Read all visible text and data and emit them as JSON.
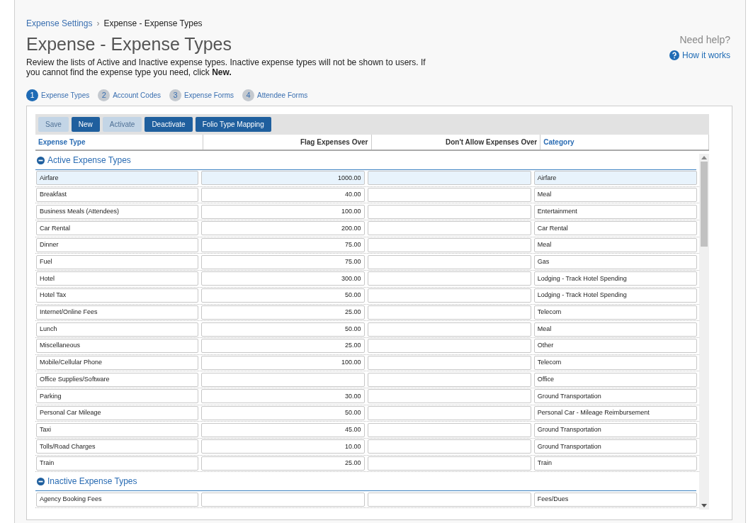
{
  "breadcrumb": {
    "parent": "Expense Settings",
    "separator": "›",
    "current": "Expense - Expense Types"
  },
  "title": "Expense - Expense Types",
  "description": "Review the lists of Active and Inactive expense types. Inactive expense types will not be shown to users. If you cannot find the expense type you need, click **New.**",
  "help": {
    "heading": "Need help?",
    "link": "How it works"
  },
  "steps": [
    {
      "number": "1",
      "label": "Expense Types",
      "selected": true
    },
    {
      "number": "2",
      "label": "Account Codes",
      "selected": false
    },
    {
      "number": "3",
      "label": "Expense Forms",
      "selected": false
    },
    {
      "number": "4",
      "label": "Attendee Forms",
      "selected": false
    }
  ],
  "toolbar": [
    {
      "label": "Save",
      "disabled": true
    },
    {
      "label": "New",
      "disabled": false
    },
    {
      "label": "Activate",
      "disabled": true
    },
    {
      "label": "Deactivate",
      "disabled": false
    },
    {
      "label": "Folio Type Mapping",
      "disabled": false
    }
  ],
  "columns": [
    {
      "label": "Expense Type",
      "highlighted": true
    },
    {
      "label": "Flag Expenses Over",
      "highlighted": false
    },
    {
      "label": "Don't Allow Expenses Over",
      "highlighted": false
    },
    {
      "label": "Category",
      "highlighted": true
    }
  ],
  "groups": [
    {
      "title": "Active Expense Types",
      "expanded": true,
      "rows": [
        {
          "cells": [
            "Airfare",
            "1000.00",
            "",
            "Airfare"
          ],
          "selected": true
        },
        {
          "cells": [
            "Breakfast",
            "40.00",
            "",
            "Meal"
          ],
          "selected": false
        },
        {
          "cells": [
            "Business Meals (Attendees)",
            "100.00",
            "",
            "Entertainment"
          ],
          "selected": false
        },
        {
          "cells": [
            "Car Rental",
            "200.00",
            "",
            "Car Rental"
          ],
          "selected": false
        },
        {
          "cells": [
            "Dinner",
            "75.00",
            "",
            "Meal"
          ],
          "selected": false
        },
        {
          "cells": [
            "Fuel",
            "75.00",
            "",
            "Gas"
          ],
          "selected": false
        },
        {
          "cells": [
            "Hotel",
            "300.00",
            "",
            "Lodging - Track Hotel Spending"
          ],
          "selected": false
        },
        {
          "cells": [
            "Hotel Tax",
            "50.00",
            "",
            "Lodging - Track Hotel Spending"
          ],
          "selected": false
        },
        {
          "cells": [
            "Internet/Online Fees",
            "25.00",
            "",
            "Telecom"
          ],
          "selected": false
        },
        {
          "cells": [
            "Lunch",
            "50.00",
            "",
            "Meal"
          ],
          "selected": false
        },
        {
          "cells": [
            "Miscellaneous",
            "25.00",
            "",
            "Other"
          ],
          "selected": false
        },
        {
          "cells": [
            "Mobile/Cellular Phone",
            "100.00",
            "",
            "Telecom"
          ],
          "selected": false
        },
        {
          "cells": [
            "Office Supplies/Software",
            "",
            "",
            "Office"
          ],
          "selected": false
        },
        {
          "cells": [
            "Parking",
            "30.00",
            "",
            "Ground Transportation"
          ],
          "selected": false
        },
        {
          "cells": [
            "Personal Car Mileage",
            "50.00",
            "",
            "Personal Car - Mileage Reimbursement"
          ],
          "selected": false
        },
        {
          "cells": [
            "Taxi",
            "45.00",
            "",
            "Ground Transportation"
          ],
          "selected": false
        },
        {
          "cells": [
            "Tolls/Road Charges",
            "10.00",
            "",
            "Ground Transportation"
          ],
          "selected": false
        },
        {
          "cells": [
            "Train",
            "25.00",
            "",
            "Train"
          ],
          "selected": false
        }
      ]
    },
    {
      "title": "Inactive Expense Types",
      "expanded": true,
      "rows": [
        {
          "cells": [
            "Agency Booking Fees",
            "",
            "",
            "Fees/Dues"
          ],
          "selected": false
        }
      ]
    }
  ]
}
